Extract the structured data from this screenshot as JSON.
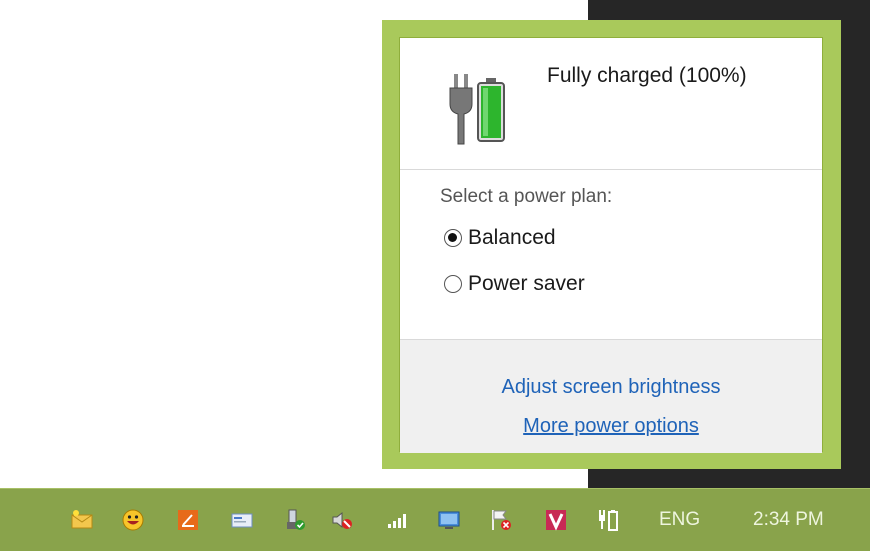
{
  "power_flyout": {
    "status_text": "Fully charged (100%)",
    "battery_level_percent": 100,
    "plan_label": "Select a power plan:",
    "plans": [
      {
        "label": "Balanced",
        "selected": true
      },
      {
        "label": "Power saver",
        "selected": false
      }
    ],
    "links": {
      "adjust_brightness": "Adjust screen brightness",
      "more_options": "More power options"
    }
  },
  "taskbar": {
    "language": "ENG",
    "clock": "2:34 PM",
    "tray_icons": [
      "mail-notification-icon",
      "emoji-messenger-icon",
      "notes-icon",
      "card-icon",
      "usb-device-icon",
      "volume-muted-icon",
      "network-signal-icon",
      "display-icon",
      "action-center-flag-icon",
      "v-app-icon",
      "power-battery-icon"
    ]
  },
  "colors": {
    "flyout_border": "#a9c95b",
    "taskbar": "#89a34b",
    "link": "#1f63b8",
    "desktop_dark": "#262626"
  }
}
